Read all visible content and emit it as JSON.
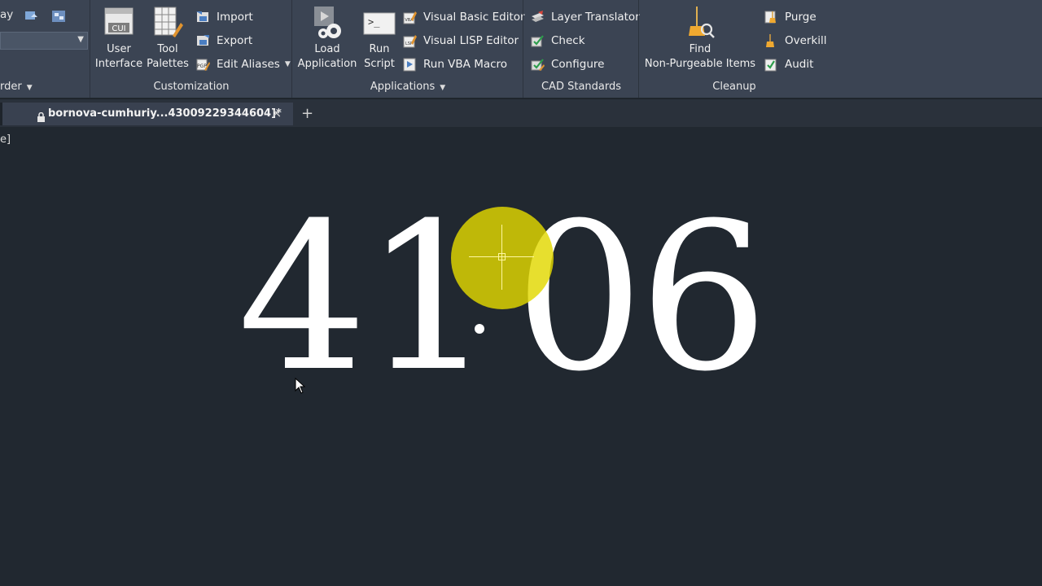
{
  "ribbon": {
    "left_partial": {
      "label_top": "ay",
      "label_bottom": "rder"
    },
    "customization": {
      "title": "Customization",
      "user_interface": "User\nInterface",
      "tool_palettes": "Tool\nPalettes",
      "import": "Import",
      "export": "Export",
      "edit_aliases": "Edit Aliases"
    },
    "applications": {
      "title": "Applications",
      "load_application": "Load\nApplication",
      "run_script": "Run\nScript",
      "vba_editor": "Visual Basic Editor",
      "lisp_editor": "Visual LISP Editor",
      "run_vba": "Run VBA Macro"
    },
    "cad_standards": {
      "title": "CAD Standards",
      "layer_translator": "Layer Translator",
      "check": "Check",
      "configure": "Configure"
    },
    "cleanup": {
      "title": "Cleanup",
      "find_nonpurgeable": "Find\nNon-Purgeable Items",
      "purge": "Purge",
      "overkill": "Overkill",
      "audit": "Audit"
    }
  },
  "tabs": {
    "document": "bornova-cumhuriy...43009229344604]*",
    "close_icon": "×",
    "new_tab": "+"
  },
  "canvas": {
    "view_label": "e]",
    "number_left": "41",
    "number_right": "06"
  },
  "colors": {
    "ribbon_bg": "#3b4453",
    "canvas_bg": "#212830",
    "highlight": "#e2d800"
  }
}
